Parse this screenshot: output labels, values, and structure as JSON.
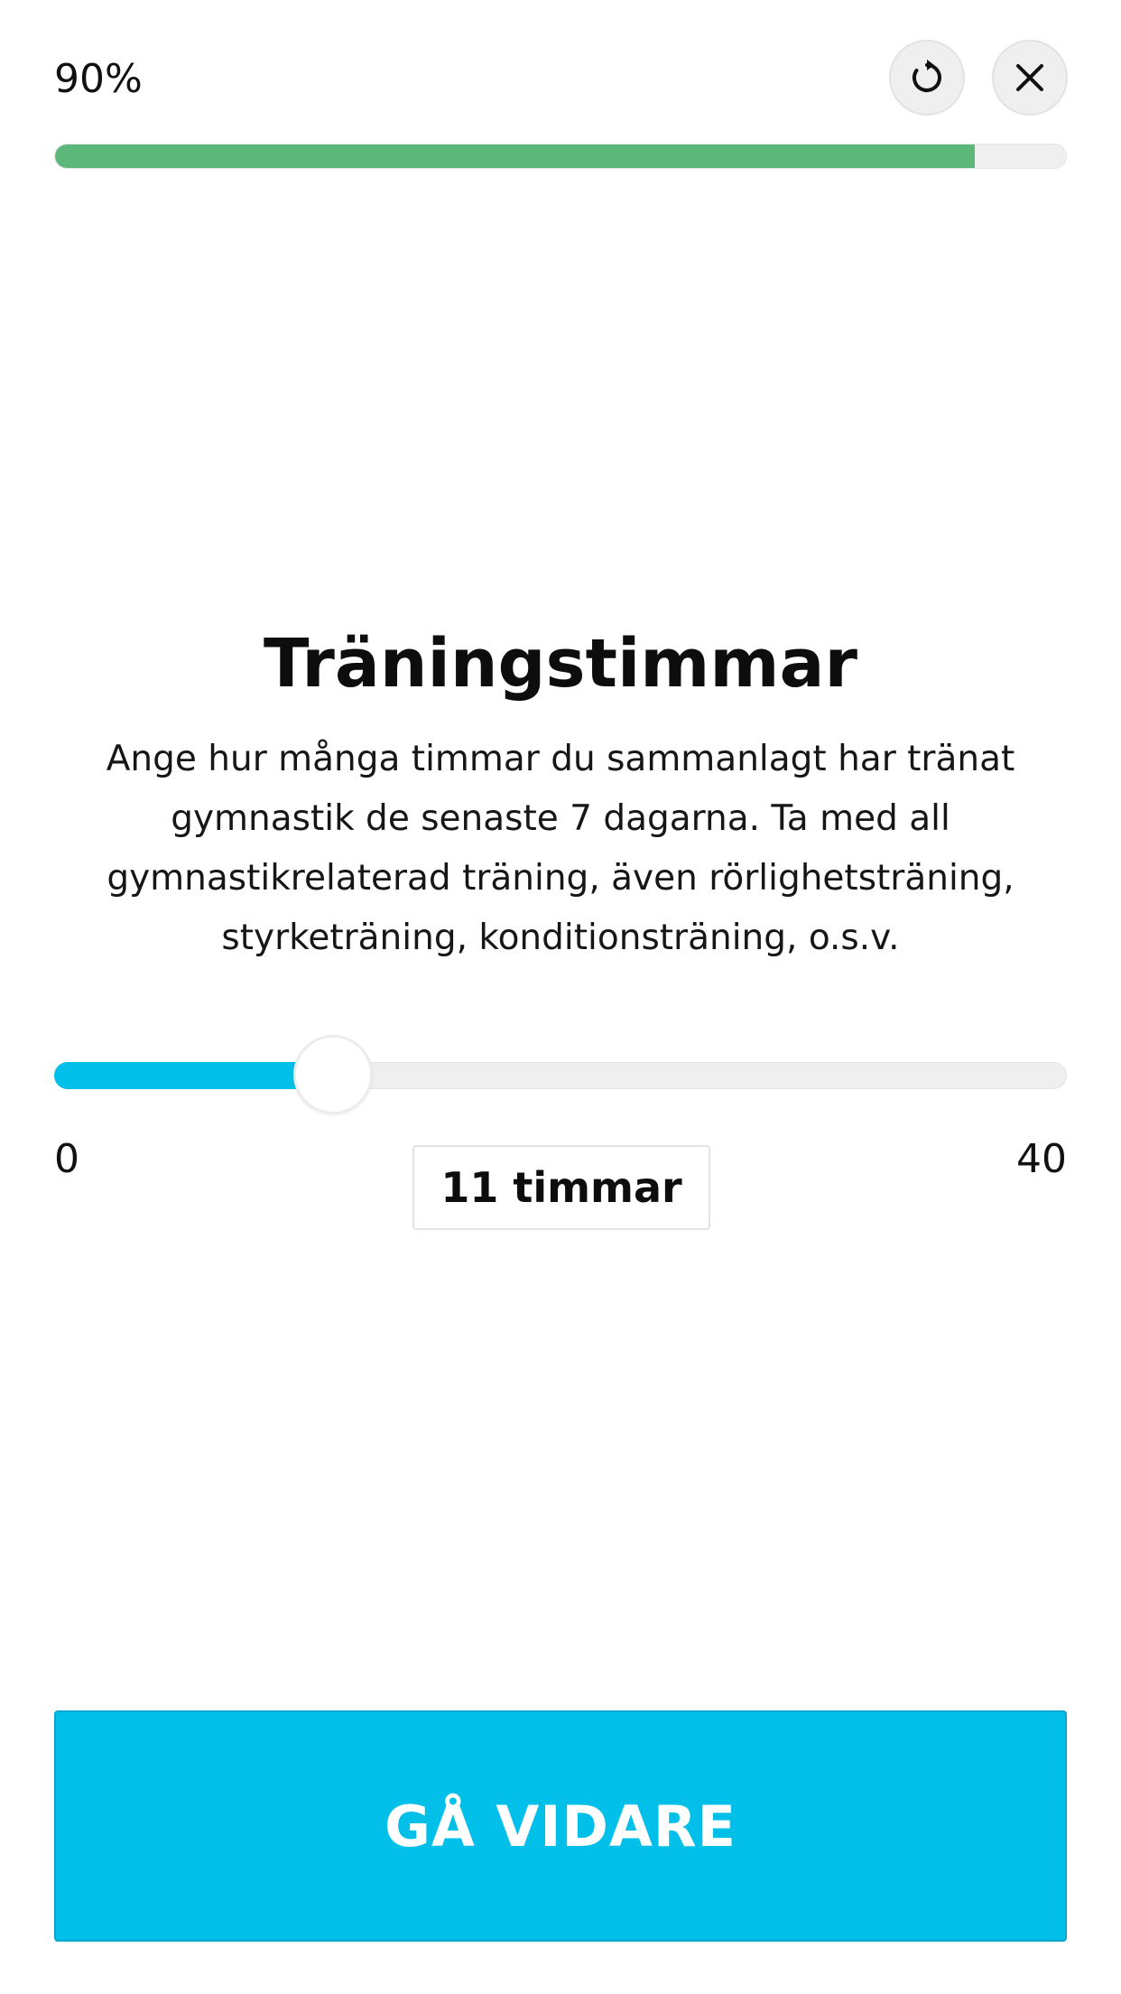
{
  "header": {
    "progress_text": "90%",
    "progress_fraction": 0.91,
    "restart_icon": "restart-icon",
    "close_icon": "close-icon"
  },
  "question": {
    "title": "Träningstimmar",
    "description_lines": [
      "Ange hur många timmar du sammanlagt har tränat",
      "gymnastik de senaste 7 dagarna. Ta med all",
      "gymnastikrelaterad träning, även rörlighetsträning,",
      "styrketräning, konditionsträning, o.s.v."
    ]
  },
  "slider": {
    "min_label": "0",
    "max_label": "40",
    "min": 0,
    "max": 40,
    "value": 11,
    "value_label": "11 timmar"
  },
  "actions": {
    "continue_label": "GÅ VIDARE"
  },
  "colors": {
    "progress_fill": "#5cb87a",
    "accent": "#00bfe8",
    "track": "#efefef"
  }
}
